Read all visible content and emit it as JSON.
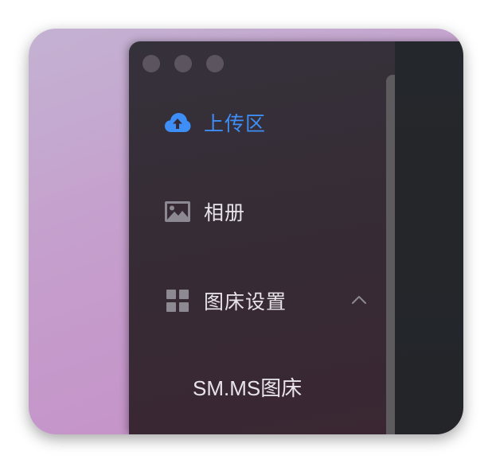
{
  "colors": {
    "accent": "#3e8ef7",
    "text": "#e8e4ea",
    "icon_muted": "#8c8992",
    "sidebar_bg": "#362b35",
    "main_bg": "#24272b",
    "scrollbar": "#5e5b5f",
    "traffic_light": "#5c5560"
  },
  "sidebar": {
    "items": [
      {
        "label": "上传区",
        "icon": "cloud-upload-icon",
        "active": true
      },
      {
        "label": "相册",
        "icon": "image-icon",
        "active": false
      },
      {
        "label": "图床设置",
        "icon": "grid-icon",
        "active": false,
        "expanded": true,
        "children": [
          {
            "label": "SM.MS图床"
          }
        ]
      }
    ]
  }
}
